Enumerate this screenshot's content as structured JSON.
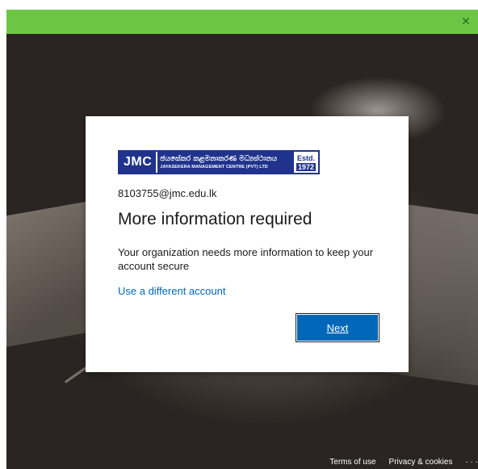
{
  "window": {
    "close_glyph": "✕",
    "titlebar_color": "#6cc644"
  },
  "logo": {
    "abbrev": "JMC",
    "sinhala_name": "ජයසේකර කළමනාකරණ මධ්‍යස්ථානය",
    "english_name": "JAYASEKERA MANAGEMENT CENTRE (PVT) LTD",
    "estd_label": "Estd.",
    "estd_year": "1972",
    "brand_color": "#20338c"
  },
  "signin": {
    "email": "8103755@jmc.edu.lk",
    "heading": "More information required",
    "description": "Your organization needs more information to keep your account secure",
    "alt_account_link": "Use a different account",
    "next_label": "Next",
    "accent_color": "#0067b8"
  },
  "footer": {
    "terms": "Terms of use",
    "privacy": "Privacy & cookies",
    "more": "· · ·"
  }
}
